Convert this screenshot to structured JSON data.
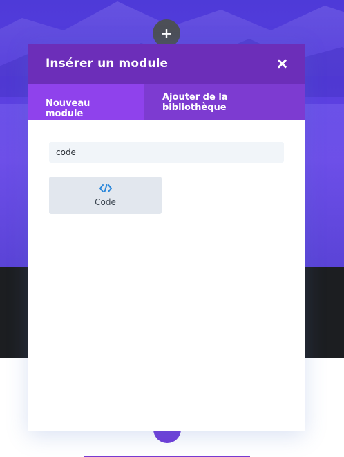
{
  "modal": {
    "title": "Insérer un module",
    "tabs": [
      {
        "label": "Nouveau module",
        "active": true
      },
      {
        "label": "Ajouter de la bibliothèque",
        "active": false
      }
    ],
    "search": {
      "value": "code"
    },
    "modules": [
      {
        "label": "Code",
        "icon": "code-icon"
      }
    ]
  },
  "colors": {
    "header": "#6c2eb9",
    "tab_bar": "#7d3bd1",
    "tab_active": "#8f42ec",
    "hero": "#5a3fe0",
    "dark_band": "#1c1e21",
    "code_icon": "#2b87da"
  },
  "controls": {
    "add_button_label": "+"
  }
}
